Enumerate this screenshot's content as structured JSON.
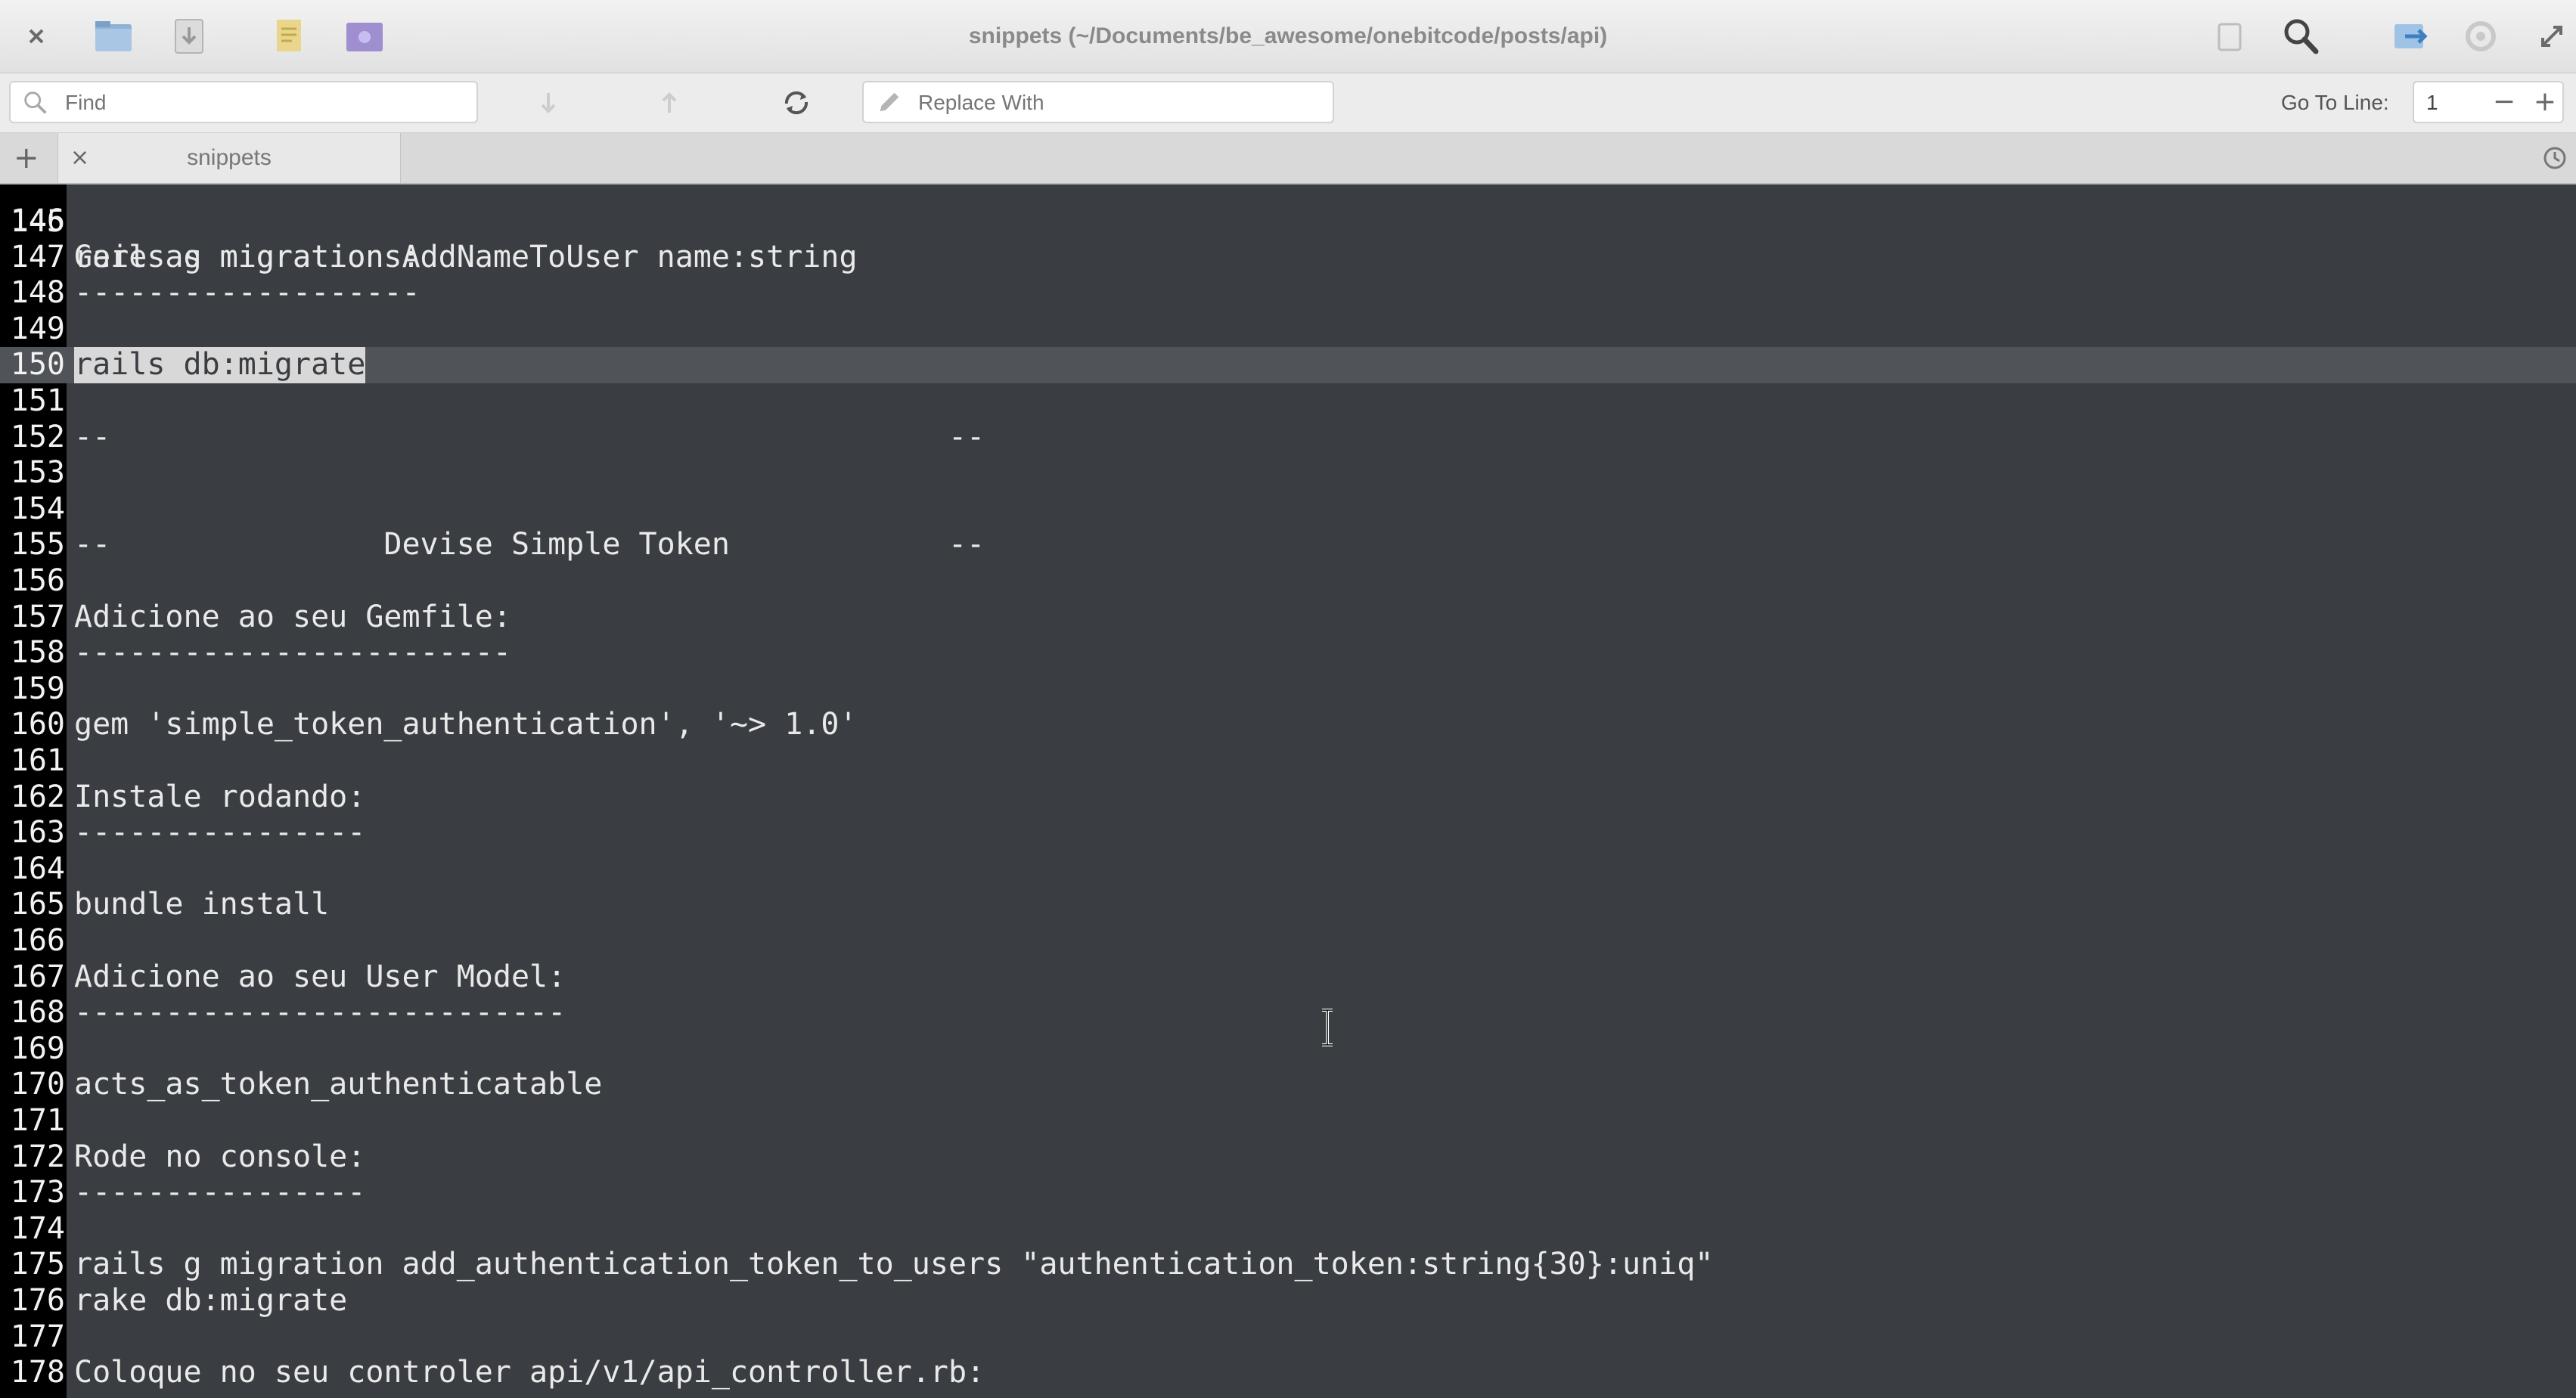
{
  "window": {
    "title": "snippets (~/Documents/be_awesome/onebitcode/posts/api)"
  },
  "toolbar": {
    "icons": [
      "close-icon",
      "open-folder-icon",
      "save-icon",
      "open-file-icon",
      "save-as-icon",
      "find-icon",
      "search-icon",
      "share-icon",
      "settings-icon",
      "fullscreen-icon"
    ]
  },
  "findbar": {
    "find_placeholder": "Find",
    "replace_placeholder": "Replace With",
    "goto_label": "Go To Line:",
    "goto_value": "1",
    "minus": "−",
    "plus": "+"
  },
  "tabs": {
    "new_tab": "+",
    "close": "×",
    "items": [
      {
        "label": "snippets"
      }
    ]
  },
  "editor": {
    "lines": [
      {
        "num": "146",
        "code": ""
      },
      {
        "num": "147",
        "code": "Gere as migrations:"
      },
      {
        "num": "148",
        "code": "-------------------"
      },
      {
        "num": "149",
        "code": ""
      },
      {
        "num": "150",
        "code": "rails db:migrate"
      },
      {
        "num": "151",
        "code": ""
      },
      {
        "num": "152",
        "code": "--                                              --"
      },
      {
        "num": "153",
        "code": ""
      },
      {
        "num": "154",
        "code": ""
      },
      {
        "num": "155",
        "code": "--               Devise Simple Token            --"
      },
      {
        "num": "156",
        "code": ""
      },
      {
        "num": "157",
        "code": "Adicione ao seu Gemfile:"
      },
      {
        "num": "158",
        "code": "------------------------"
      },
      {
        "num": "159",
        "code": ""
      },
      {
        "num": "160",
        "code": "gem 'simple_token_authentication', '~> 1.0'"
      },
      {
        "num": "161",
        "code": ""
      },
      {
        "num": "162",
        "code": "Instale rodando:"
      },
      {
        "num": "163",
        "code": "----------------"
      },
      {
        "num": "164",
        "code": ""
      },
      {
        "num": "165",
        "code": "bundle install"
      },
      {
        "num": "166",
        "code": ""
      },
      {
        "num": "167",
        "code": "Adicione ao seu User Model:"
      },
      {
        "num": "168",
        "code": "---------------------------"
      },
      {
        "num": "169",
        "code": ""
      },
      {
        "num": "170",
        "code": "acts_as_token_authenticatable"
      },
      {
        "num": "171",
        "code": ""
      },
      {
        "num": "172",
        "code": "Rode no console:"
      },
      {
        "num": "173",
        "code": "----------------"
      },
      {
        "num": "174",
        "code": ""
      },
      {
        "num": "175",
        "code": "rails g migration add_authentication_token_to_users \"authentication_token:string{30}:uniq\""
      },
      {
        "num": "176",
        "code": "rake db:migrate"
      },
      {
        "num": "177",
        "code": ""
      },
      {
        "num": "178",
        "code": "Coloque no seu controler api/v1/api_controller.rb:"
      }
    ],
    "current_line": "150"
  }
}
